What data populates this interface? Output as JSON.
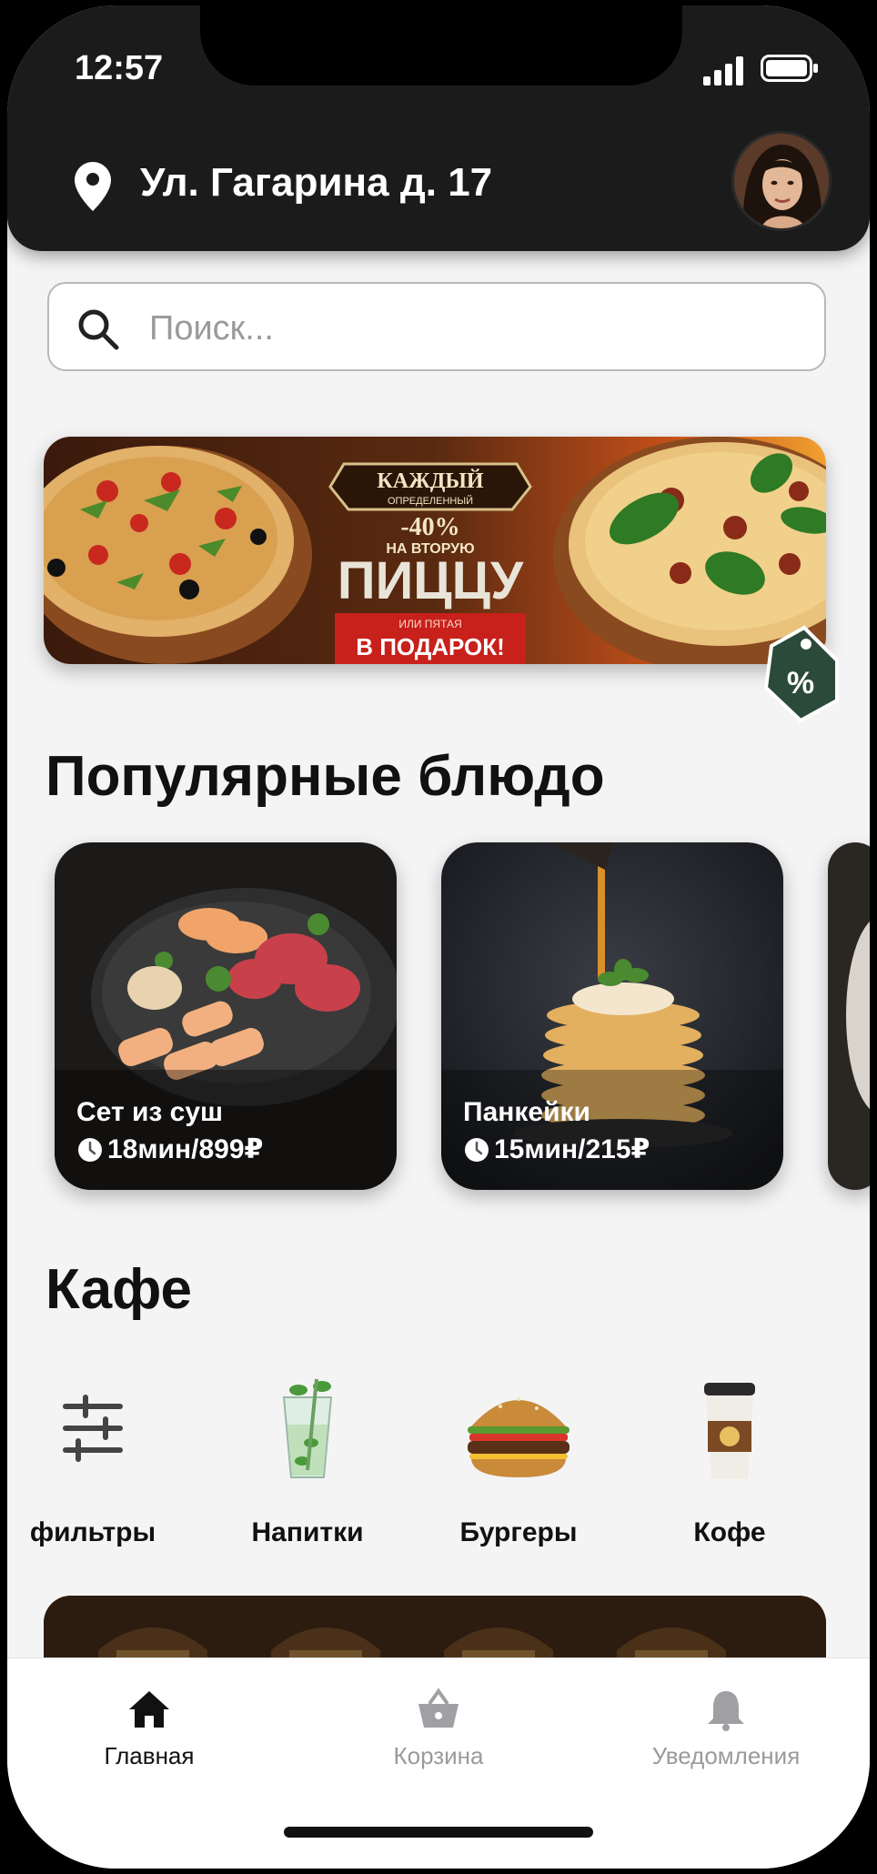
{
  "status_bar": {
    "time": "12:57"
  },
  "header": {
    "address": "Ул. Гагарина д. 17",
    "location_icon": "location-pin-icon"
  },
  "search": {
    "placeholder": "Поиск...",
    "icon": "search-icon"
  },
  "promo_banner": {
    "badge_top": "КАЖДЫЙ",
    "badge_sub": "ОПРЕДЕЛЕННЫЙ",
    "discount": "-40%",
    "line1": "НА ВТОРУЮ",
    "headline": "ПИЦЦУ",
    "line2": "ИЛИ ПЯТАЯ",
    "pill": "В ПОДАРОК!"
  },
  "popular": {
    "title": "Популярные блюдо",
    "items": [
      {
        "name": "Сет из суш",
        "meta": "18мин/899₽"
      },
      {
        "name": "Панкейки",
        "meta": "15мин/215₽"
      }
    ]
  },
  "cafe": {
    "title": "Кафе",
    "categories": [
      {
        "label": "фильтры",
        "icon": "filters-icon"
      },
      {
        "label": "Напитки",
        "icon": "drink-icon"
      },
      {
        "label": "Бургеры",
        "icon": "burger-icon"
      },
      {
        "label": "Кофе",
        "icon": "coffee-cup-icon"
      }
    ]
  },
  "nav": {
    "items": [
      {
        "label": "Главная",
        "icon": "home-icon",
        "active": true
      },
      {
        "label": "Корзина",
        "icon": "basket-icon",
        "active": false
      },
      {
        "label": "Уведомления",
        "icon": "bell-icon",
        "active": false
      }
    ]
  },
  "colors": {
    "header_bg": "#1b1b1b",
    "accent_red": "#c8201b",
    "nav_active": "#111111",
    "nav_inactive": "#9a9a9e"
  }
}
